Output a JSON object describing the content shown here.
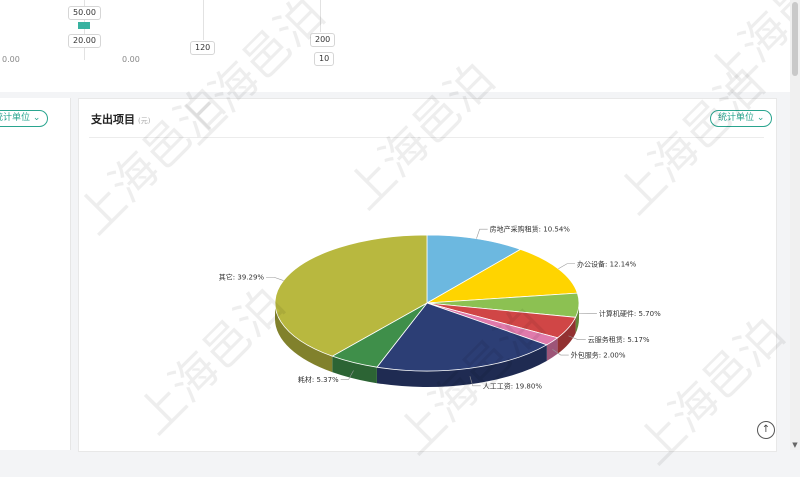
{
  "top_values": {
    "a": "50.00",
    "b": "20.00",
    "c": "120",
    "d": "200",
    "e": "10",
    "zero_left": "0.00",
    "zero_mid": "0.00"
  },
  "left_card": {
    "unit_button": "统计单位"
  },
  "card": {
    "title": "支出项目",
    "subtitle": "(元)",
    "unit_button": "统计单位"
  },
  "watermark": "上海邑泊",
  "colors": {
    "accent": "#2aa58f",
    "slices": [
      "#6cb8e0",
      "#ffd400",
      "#8cc152",
      "#d04646",
      "#e07aab",
      "#2c3e75",
      "#3f8f4a",
      "#b8b83f"
    ]
  },
  "chart_data": {
    "type": "pie",
    "title": "支出项目",
    "style": "3d",
    "slices": [
      {
        "label": "房地产采购租赁: 10.54%",
        "value": 10.54
      },
      {
        "label": "办公设备: 12.14%",
        "value": 12.14
      },
      {
        "label": "计算机硬件: 5.70%",
        "value": 5.7
      },
      {
        "label": "云服务租赁: 5.17%",
        "value": 5.17
      },
      {
        "label": "外包服务: 2.00%",
        "value": 2.0
      },
      {
        "label": "人工工资: 19.80%",
        "value": 19.8
      },
      {
        "label": "耗材: 5.37%",
        "value": 5.37
      },
      {
        "label": "其它: 39.29%",
        "value": 39.29
      }
    ]
  }
}
